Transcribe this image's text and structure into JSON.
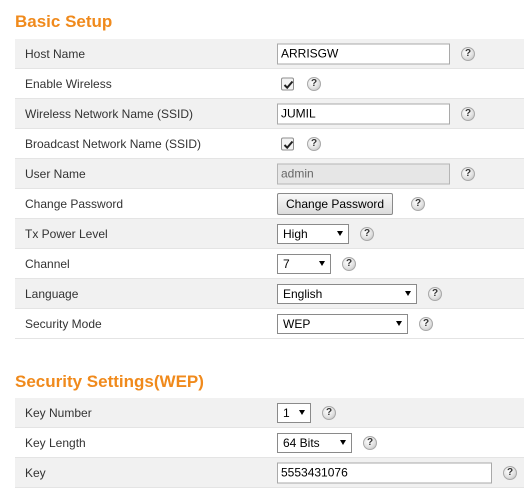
{
  "basic_setup": {
    "title": "Basic Setup",
    "host_name": {
      "label": "Host Name",
      "value": "ARRISGW"
    },
    "enable_wireless": {
      "label": "Enable Wireless",
      "checked": true
    },
    "ssid": {
      "label": "Wireless Network Name (SSID)",
      "value": "JUMIL"
    },
    "broadcast_ssid": {
      "label": "Broadcast Network Name (SSID)",
      "checked": true
    },
    "user_name": {
      "label": "User Name",
      "value": "admin"
    },
    "change_password": {
      "label": "Change Password",
      "button_label": "Change Password"
    },
    "tx_power": {
      "label": "Tx Power Level",
      "selected": "High"
    },
    "channel": {
      "label": "Channel",
      "selected": "7"
    },
    "language": {
      "label": "Language",
      "selected": "English"
    },
    "security_mode": {
      "label": "Security Mode",
      "selected": "WEP"
    }
  },
  "security_settings": {
    "title": "Security Settings(WEP)",
    "key_number": {
      "label": "Key Number",
      "selected": "1"
    },
    "key_length": {
      "label": "Key Length",
      "selected": "64 Bits"
    },
    "key": {
      "label": "Key",
      "value": "5553431076"
    }
  },
  "help_icon_glyph": "?",
  "colors": {
    "accent": "#f08a1c",
    "row_shade": "#f1f1f1"
  }
}
